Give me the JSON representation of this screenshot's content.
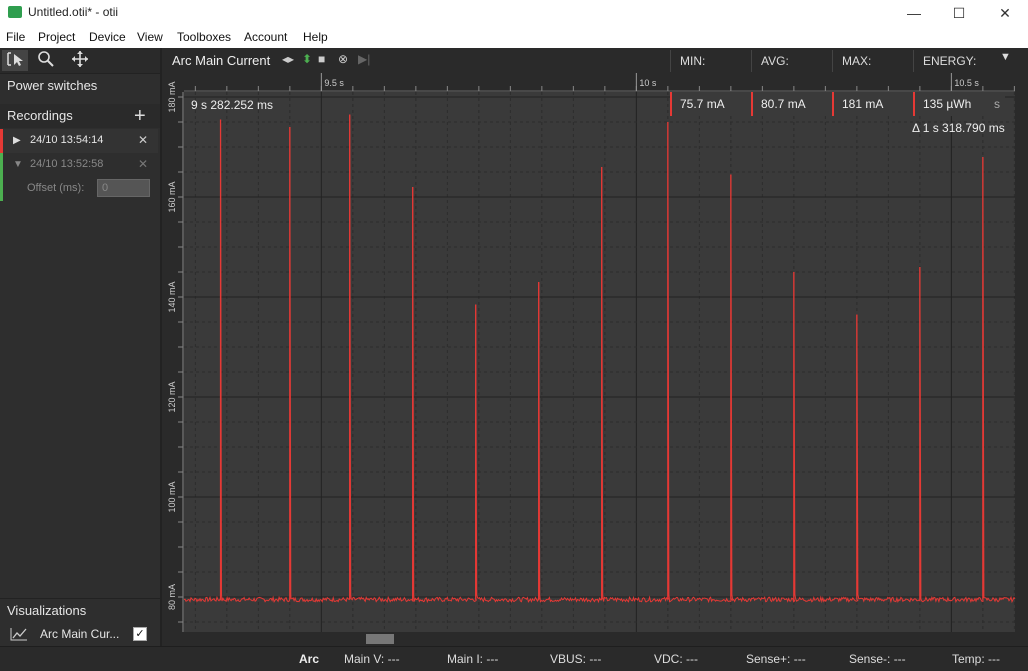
{
  "window": {
    "title": "Untitled.otii* - otii",
    "minimize": "—",
    "maximize": "☐",
    "close": "✕"
  },
  "menu": [
    "File",
    "Project",
    "Device",
    "View",
    "Toolboxes",
    "Account",
    "Help"
  ],
  "sidebar": {
    "power_switches": "Power switches",
    "recordings_label": "Recordings",
    "add_label": "+",
    "recordings": [
      {
        "label": "24/10 13:54:14",
        "color": "#e53935",
        "expanded": false
      },
      {
        "label": "24/10 13:52:58",
        "color": "#4caf50",
        "expanded": true
      }
    ],
    "offset_label": "Offset (ms):",
    "offset_value": "0",
    "visualizations_label": "Visualizations",
    "viz_item": "Arc Main Cur..."
  },
  "chart_header": {
    "title": "Arc Main Current",
    "min_label": "MIN:",
    "avg_label": "AVG:",
    "max_label": "MAX:",
    "energy_label": "ENERGY:",
    "min_value": "75.7 mA",
    "avg_value": "80.7 mA",
    "max_value": "181 mA",
    "energy_value": "135 µWh",
    "energy_unit_suffix": "s",
    "cursor_time": "9 s 282.252 ms",
    "delta": "Δ 1 s 318.790 ms"
  },
  "status": {
    "device": "Arc",
    "main_v": "Main V: ---",
    "main_i": "Main I: ---",
    "vbus": "VBUS: ---",
    "vdc": "VDC: ---",
    "sense_plus": "Sense+: ---",
    "sense_minus": "Sense-: ---",
    "temp": "Temp: ---"
  },
  "chart_data": {
    "type": "line",
    "x_ticks": [
      "9.5 s",
      "10 s",
      "10.5 s"
    ],
    "y_ticks": [
      "80 mA",
      "100 mA",
      "120 mA",
      "140 mA",
      "160 mA",
      "180 mA"
    ],
    "xlim": [
      9.282,
      10.601
    ],
    "ylim": [
      73,
      181
    ],
    "grid": true,
    "series": [
      {
        "color": "#e53935",
        "baseline": 79.5,
        "spikes": [
          {
            "t": 9.34,
            "peak": 175.5
          },
          {
            "t": 9.45,
            "peak": 174
          },
          {
            "t": 9.545,
            "peak": 176.5
          },
          {
            "t": 9.645,
            "peak": 162
          },
          {
            "t": 9.745,
            "peak": 138.5
          },
          {
            "t": 9.845,
            "peak": 143
          },
          {
            "t": 9.945,
            "peak": 166
          },
          {
            "t": 10.05,
            "peak": 175
          },
          {
            "t": 10.15,
            "peak": 164.5
          },
          {
            "t": 10.25,
            "peak": 145
          },
          {
            "t": 10.35,
            "peak": 136.5
          },
          {
            "t": 10.45,
            "peak": 146
          },
          {
            "t": 10.55,
            "peak": 168
          }
        ]
      }
    ]
  }
}
